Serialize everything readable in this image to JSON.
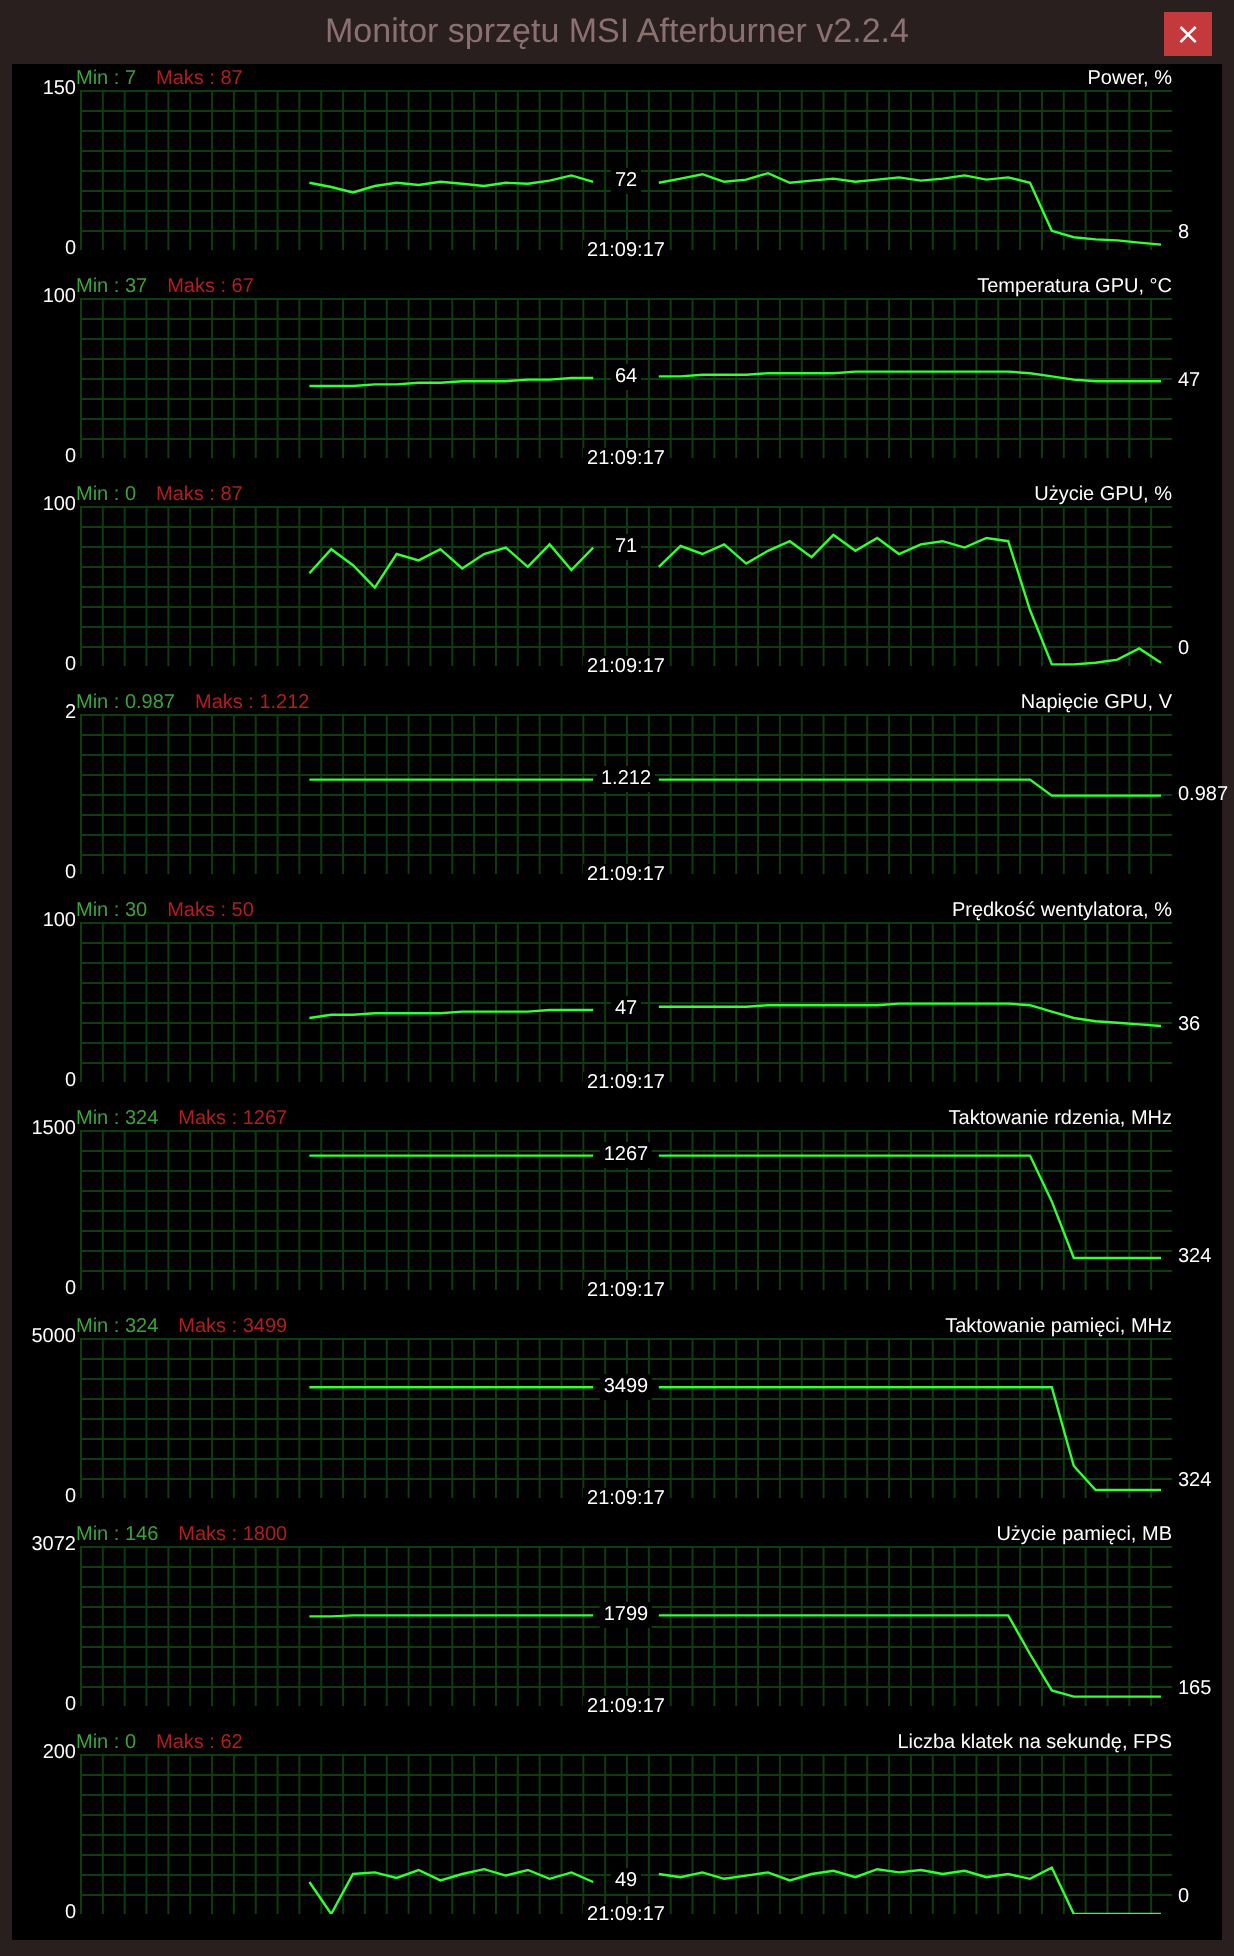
{
  "window": {
    "title": "Monitor sprzętu MSI Afterburner v2.2.4",
    "close": "×"
  },
  "graphs": [
    {
      "min": "Min : 7",
      "max": "Maks : 87",
      "mid_value": "72",
      "current": "8",
      "time": "21:09:17",
      "chart_data": {
        "type": "line",
        "grid": true,
        "ylim": [
          0,
          150
        ],
        "yticks": [
          0,
          150
        ],
        "series": [
          {
            "name": "Power, %",
            "color": "#33ff33",
            "values": [
              null,
              null,
              null,
              null,
              null,
              null,
              null,
              null,
              null,
              null,
              63,
              59,
              54,
              60,
              63,
              61,
              64,
              62,
              60,
              63,
              62,
              65,
              70,
              64,
              null,
              null,
              63,
              67,
              71,
              64,
              66,
              72,
              63,
              65,
              67,
              64,
              66,
              68,
              65,
              67,
              70,
              66,
              68,
              63,
              18,
              12,
              10,
              9,
              7,
              5
            ]
          }
        ]
      }
    },
    {
      "min": "Min : 37",
      "max": "Maks : 67",
      "mid_value": "64",
      "current": "47",
      "time": "21:09:17",
      "chart_data": {
        "type": "line",
        "grid": true,
        "ylim": [
          0,
          100
        ],
        "yticks": [
          0,
          100
        ],
        "series": [
          {
            "name": "Temperatura GPU, °C",
            "color": "#33ff33",
            "values": [
              null,
              null,
              null,
              null,
              null,
              null,
              null,
              null,
              null,
              null,
              45,
              45,
              45,
              46,
              46,
              47,
              47,
              48,
              48,
              48,
              49,
              49,
              50,
              50,
              null,
              null,
              51,
              51,
              52,
              52,
              52,
              53,
              53,
              53,
              53,
              54,
              54,
              54,
              54,
              54,
              54,
              54,
              54,
              53,
              51,
              49,
              48,
              48,
              48,
              48
            ]
          }
        ]
      }
    },
    {
      "min": "Min : 0",
      "max": "Maks : 87",
      "mid_value": "71",
      "current": "0",
      "time": "21:09:17",
      "chart_data": {
        "type": "line",
        "grid": true,
        "ylim": [
          0,
          100
        ],
        "yticks": [
          0,
          100
        ],
        "series": [
          {
            "name": "Użycie GPU, %",
            "color": "#33ff33",
            "values": [
              null,
              null,
              null,
              null,
              null,
              null,
              null,
              null,
              null,
              null,
              58,
              73,
              63,
              49,
              70,
              66,
              73,
              61,
              70,
              74,
              62,
              76,
              60,
              74,
              null,
              null,
              62,
              75,
              70,
              76,
              64,
              72,
              78,
              68,
              82,
              72,
              80,
              70,
              76,
              78,
              74,
              80,
              78,
              35,
              1,
              1,
              2,
              4,
              11,
              2
            ]
          }
        ]
      }
    },
    {
      "min": "Min : 0.987",
      "max": "Maks : 1.212",
      "mid_value": "1.212",
      "current": "0.987",
      "time": "21:09:17",
      "chart_data": {
        "type": "line",
        "grid": true,
        "ylim": [
          0,
          2
        ],
        "yticks": [
          0,
          2
        ],
        "series": [
          {
            "name": "Napięcie GPU, V",
            "color": "#33ff33",
            "values": [
              null,
              null,
              null,
              null,
              null,
              null,
              null,
              null,
              null,
              null,
              1.18,
              1.18,
              1.18,
              1.18,
              1.18,
              1.18,
              1.18,
              1.18,
              1.18,
              1.18,
              1.18,
              1.18,
              1.18,
              1.18,
              null,
              null,
              1.18,
              1.18,
              1.18,
              1.18,
              1.18,
              1.18,
              1.18,
              1.18,
              1.18,
              1.18,
              1.18,
              1.18,
              1.18,
              1.18,
              1.18,
              1.18,
              1.18,
              1.18,
              0.98,
              0.98,
              0.98,
              0.98,
              0.98,
              0.98
            ]
          }
        ]
      }
    },
    {
      "min": "Min : 30",
      "max": "Maks : 50",
      "mid_value": "47",
      "current": "36",
      "time": "21:09:17",
      "chart_data": {
        "type": "line",
        "grid": true,
        "ylim": [
          0,
          100
        ],
        "yticks": [
          0,
          100
        ],
        "series": [
          {
            "name": "Prędkość wentylatora, %",
            "color": "#33ff33",
            "values": [
              null,
              null,
              null,
              null,
              null,
              null,
              null,
              null,
              null,
              null,
              40,
              42,
              42,
              43,
              43,
              43,
              43,
              44,
              44,
              44,
              44,
              45,
              45,
              45,
              null,
              null,
              47,
              47,
              47,
              47,
              47,
              48,
              48,
              48,
              48,
              48,
              48,
              49,
              49,
              49,
              49,
              49,
              49,
              48,
              44,
              40,
              38,
              37,
              36,
              35
            ]
          }
        ]
      }
    },
    {
      "min": "Min : 324",
      "max": "Maks : 1267",
      "mid_value": "1267",
      "current": "324",
      "time": "21:09:17",
      "chart_data": {
        "type": "line",
        "grid": true,
        "ylim": [
          0,
          1500
        ],
        "yticks": [
          0,
          1500
        ],
        "series": [
          {
            "name": "Taktowanie rdzenia, MHz",
            "color": "#33ff33",
            "values": [
              null,
              null,
              null,
              null,
              null,
              null,
              null,
              null,
              null,
              null,
              1260,
              1260,
              1260,
              1260,
              1260,
              1260,
              1260,
              1260,
              1260,
              1260,
              1260,
              1260,
              1260,
              1260,
              null,
              null,
              1260,
              1260,
              1260,
              1260,
              1260,
              1260,
              1260,
              1260,
              1260,
              1260,
              1260,
              1260,
              1260,
              1260,
              1260,
              1260,
              1260,
              1260,
              830,
              300,
              300,
              300,
              300,
              300
            ]
          }
        ]
      }
    },
    {
      "min": "Min : 324",
      "max": "Maks : 3499",
      "mid_value": "3499",
      "current": "324",
      "time": "21:09:17",
      "chart_data": {
        "type": "line",
        "grid": true,
        "ylim": [
          0,
          5000
        ],
        "yticks": [
          0,
          5000
        ],
        "series": [
          {
            "name": "Taktowanie pamięci, MHz",
            "color": "#33ff33",
            "values": [
              null,
              null,
              null,
              null,
              null,
              null,
              null,
              null,
              null,
              null,
              3460,
              3460,
              3460,
              3460,
              3460,
              3460,
              3460,
              3460,
              3460,
              3460,
              3460,
              3460,
              3460,
              3460,
              null,
              null,
              3460,
              3460,
              3460,
              3460,
              3460,
              3460,
              3460,
              3460,
              3460,
              3460,
              3460,
              3460,
              3460,
              3460,
              3460,
              3460,
              3460,
              3460,
              3460,
              1000,
              250,
              250,
              250,
              250
            ]
          }
        ]
      }
    },
    {
      "min": "Min : 146",
      "max": "Maks : 1800",
      "mid_value": "1799",
      "current": "165",
      "time": "21:09:17",
      "chart_data": {
        "type": "line",
        "grid": true,
        "ylim": [
          0,
          3072
        ],
        "yticks": [
          0,
          3072
        ],
        "series": [
          {
            "name": "Użycie pamięci, MB",
            "color": "#33ff33",
            "values": [
              null,
              null,
              null,
              null,
              null,
              null,
              null,
              null,
              null,
              null,
              1720,
              1720,
              1740,
              1740,
              1740,
              1740,
              1740,
              1740,
              1740,
              1740,
              1740,
              1740,
              1740,
              1740,
              null,
              null,
              1740,
              1740,
              1740,
              1740,
              1740,
              1740,
              1740,
              1740,
              1740,
              1740,
              1740,
              1740,
              1740,
              1740,
              1740,
              1740,
              1740,
              1000,
              300,
              180,
              180,
              180,
              180,
              180
            ]
          }
        ]
      }
    },
    {
      "min": "Min : 0",
      "max": "Maks : 62",
      "mid_value": "49",
      "current": "0",
      "time": "21:09:17",
      "chart_data": {
        "type": "line",
        "grid": true,
        "ylim": [
          0,
          200
        ],
        "yticks": [
          0,
          200
        ],
        "series": [
          {
            "name": "Liczba klatek na sekundę, FPS",
            "color": "#33ff33",
            "values": [
              null,
              null,
              null,
              null,
              null,
              null,
              null,
              null,
              null,
              null,
              40,
              0,
              50,
              52,
              45,
              55,
              42,
              50,
              56,
              48,
              55,
              44,
              52,
              40,
              null,
              null,
              50,
              46,
              52,
              44,
              48,
              52,
              42,
              50,
              54,
              46,
              56,
              52,
              55,
              50,
              54,
              46,
              50,
              44,
              58,
              0,
              0,
              0,
              0,
              0
            ]
          }
        ]
      }
    }
  ]
}
